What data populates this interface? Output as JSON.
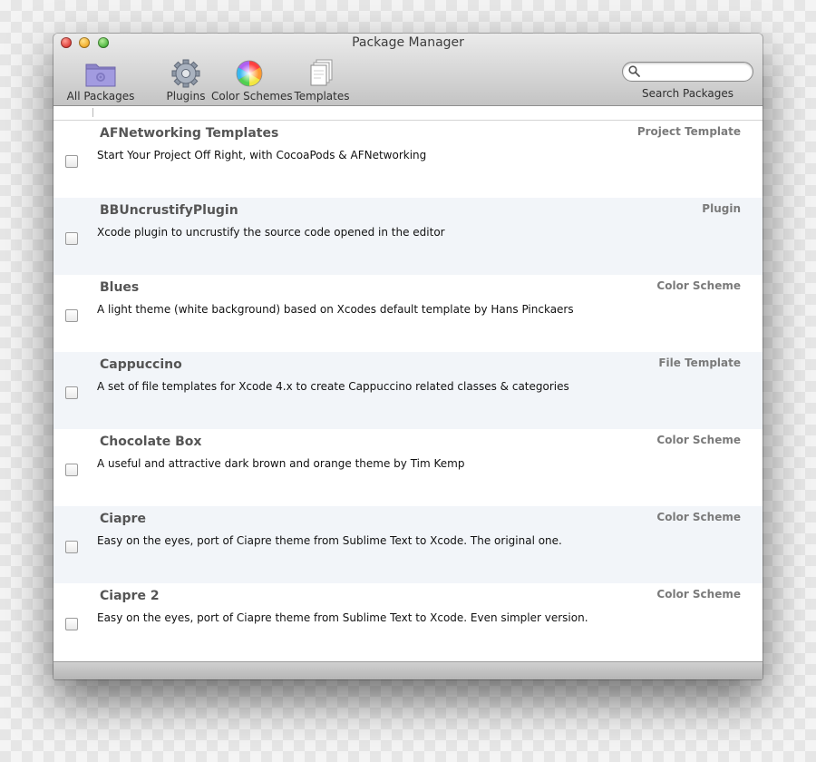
{
  "window": {
    "title": "Package Manager"
  },
  "toolbar": {
    "items": [
      {
        "label": "All Packages",
        "icon": "folder-icon"
      },
      {
        "label": "Plugins",
        "icon": "gear-icon"
      },
      {
        "label": "Color Schemes",
        "icon": "color-wheel-icon"
      },
      {
        "label": "Templates",
        "icon": "document-stack-icon"
      }
    ],
    "search": {
      "label": "Search Packages",
      "value": "",
      "placeholder": ""
    }
  },
  "packages": [
    {
      "name": "AFNetworking Templates",
      "description": "Start Your Project Off Right, with CocoaPods & AFNetworking",
      "type": "Project Template",
      "checked": false
    },
    {
      "name": "BBUncrustifyPlugin",
      "description": "Xcode plugin to uncrustify the source code opened in the editor",
      "type": "Plugin",
      "checked": false
    },
    {
      "name": "Blues",
      "description": "A light theme (white background) based on Xcodes default template by Hans Pinckaers",
      "type": "Color Scheme",
      "checked": false
    },
    {
      "name": "Cappuccino",
      "description": "A set of file templates for Xcode 4.x to create Cappuccino related classes & categories",
      "type": "File Template",
      "checked": false
    },
    {
      "name": "Chocolate Box",
      "description": "A useful and attractive dark brown and orange theme by Tim Kemp",
      "type": "Color Scheme",
      "checked": false
    },
    {
      "name": "Ciapre",
      "description": "Easy on the eyes, port of Ciapre theme from Sublime Text to Xcode. The original one.",
      "type": "Color Scheme",
      "checked": false
    },
    {
      "name": "Ciapre 2",
      "description": "Easy on the eyes, port of Ciapre theme from Sublime Text to Xcode. Even simpler version.",
      "type": "Color Scheme",
      "checked": false
    }
  ]
}
